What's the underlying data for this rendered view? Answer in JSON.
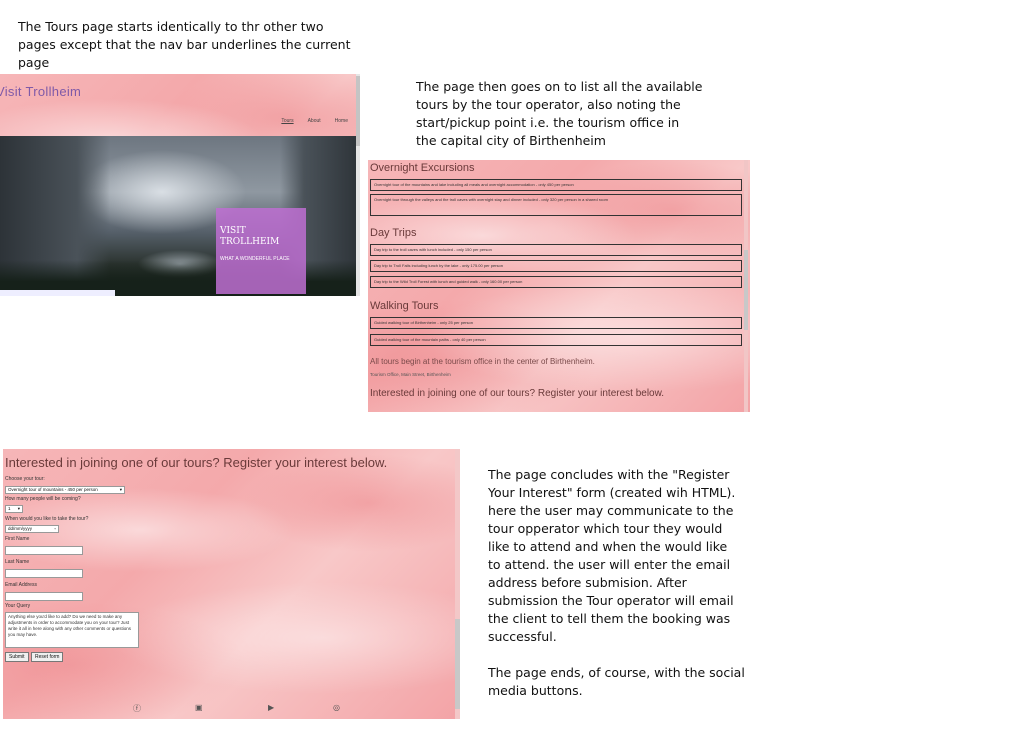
{
  "notes": {
    "note1": "The Tours page starts identically to thr other two\npages except that the nav bar underlines the current\npage",
    "note2": "The page then goes on to list all the available\ntours by the tour operator, also noting the\nstart/pickup point i.e. the tourism office in\nthe capital city of Birthenheim",
    "note3": "The page concludes with the \"Register\nYour Interest\" form (created wih HTML).\nhere the user may communicate to the\ntour opperator which tour they would\nlike to attend and when the would like\nto attend. the user will enter the email\naddress before submision. After\nsubmission the Tour operator will email\nthe client to tell them the booking was\nsuccessful.\n\nThe page ends, of course, with the social\nmedia buttons."
  },
  "panel1": {
    "brand": "Visit Trollheim",
    "nav": [
      "Tours",
      "About",
      "Home"
    ],
    "hero_title_line1": "VISIT",
    "hero_title_line2": "TROLLHEIM",
    "hero_sub": "WHAT A WONDERFUL PLACE"
  },
  "panel2": {
    "overnight_heading": "Overnight Excursions",
    "overnight": [
      "Overnight tour of the mountains and lake including all meals and overnight accommodation - only 450 per person",
      "Overnight tour through the valleys and the troll caves with overnight stay and dinner included - only 320 per person in a shared room"
    ],
    "day_heading": "Day Trips",
    "day": [
      "Day trip to the troll caves with lunch included - only 150 per person",
      "Day trip to Troll Falls including lunch by the lake - only 175.00 per person",
      "Day trip to the Wild Troll Forest with lunch and guided walk - only 160.00 per person"
    ],
    "walking_heading": "Walking Tours",
    "walking": [
      "Guided walking tour of Birthenheim - only 25 per person",
      "Guided walking tour of the mountain paths - only 40 per person"
    ],
    "start_info": "All tours begin at the tourism office in the center of Birthenheim.",
    "address": "Tourism Office, Main Street, Birthenheim",
    "interest": "Interested in joining one of our tours? Register your interest below."
  },
  "panel3": {
    "heading": "Interested in joining one of our tours? Register your interest below.",
    "choose_label": "Choose your tour:",
    "choose_value": "Overnight tour of mountains - 450 per person",
    "people_label": "How many people will be coming?",
    "people_value": "1",
    "date_label": "When would you like to take the tour?",
    "date_value": "dd/mm/yyyy",
    "first_label": "First Name",
    "last_label": "Last Name",
    "email_label": "Email Address",
    "query_label": "Your Query",
    "query_text": "Anything else you'd like to add? Do we need to make any adjustments in order to accommodate you on your tour? Just write it all in here along with any other comments or questions you may have.",
    "submit": "Submit",
    "reset": "Reset form",
    "social": [
      "facebook-icon",
      "twitter-icon",
      "youtube-icon",
      "instagram-icon"
    ]
  }
}
